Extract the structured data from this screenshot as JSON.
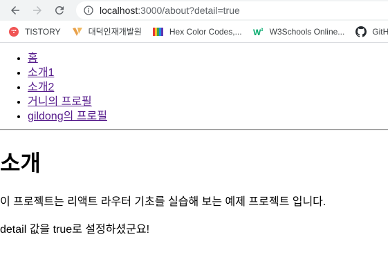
{
  "browser": {
    "url_host": "localhost",
    "url_rest": ":3000/about?detail=true",
    "bookmarks": [
      {
        "label": "TISTORY",
        "icon": "tistory-icon",
        "color": "#f05454"
      },
      {
        "label": "대덕인재개발원",
        "icon": "daedeok-icon",
        "color": "#e8a04a"
      },
      {
        "label": "Hex Color Codes,...",
        "icon": "hex-color-icon",
        "color": "#3f51b5"
      },
      {
        "label": "W3Schools Online...",
        "icon": "w3schools-icon",
        "color": "#04aa6d"
      },
      {
        "label": "GitH",
        "icon": "github-icon",
        "color": "#24292e"
      }
    ]
  },
  "nav": {
    "links": [
      {
        "label": "홈"
      },
      {
        "label": "소개1"
      },
      {
        "label": "소개2"
      },
      {
        "label": "거니의 프로필"
      },
      {
        "label": "gildong의 프로필"
      }
    ]
  },
  "content": {
    "title": "소개",
    "description": "이 프로젝트는 리액트 라우터 기초를 실습해 보는 예제 프로젝트 입니다.",
    "detail_message": "detail 값을 true로 설정하셨군요!"
  }
}
